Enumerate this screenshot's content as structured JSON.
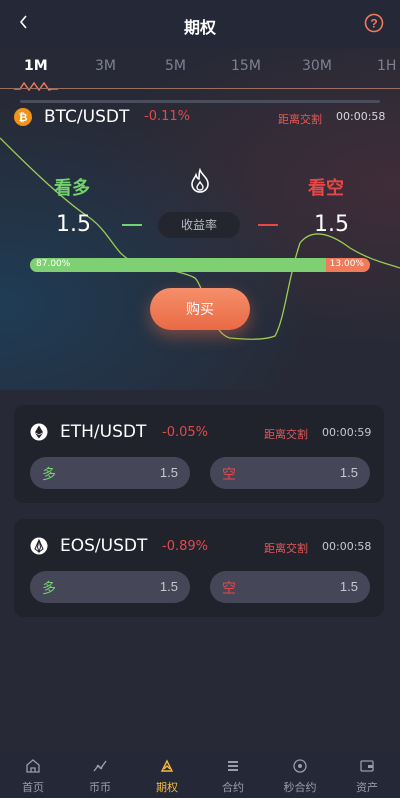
{
  "header": {
    "title": "期权"
  },
  "tabs": [
    "1M",
    "3M",
    "5M",
    "15M",
    "30M",
    "1H"
  ],
  "active_tab": "1M",
  "main_pair": {
    "name": "BTC/USDT",
    "change": "-0.11%",
    "countdown_label": "距离交割",
    "countdown": "00:00:58"
  },
  "trade": {
    "long_title": "看多",
    "short_title": "看空",
    "long_value": "1.5",
    "short_value": "1.5",
    "yield_label": "收益率",
    "long_ratio_label": "87.00%",
    "short_ratio_label": "13.00%",
    "long_ratio": 0.87,
    "buy_label": "购买"
  },
  "cards": [
    {
      "name": "ETH/USDT",
      "change": "-0.05%",
      "countdown_label": "距离交割",
      "countdown": "00:00:59",
      "long_label": "多",
      "long_value": "1.5",
      "short_label": "空",
      "short_value": "1.5"
    },
    {
      "name": "EOS/USDT",
      "change": "-0.89%",
      "countdown_label": "距离交割",
      "countdown": "00:00:58",
      "long_label": "多",
      "long_value": "1.5",
      "short_label": "空",
      "short_value": "1.5"
    }
  ],
  "nav": [
    {
      "label": "首页",
      "icon": "home-icon"
    },
    {
      "label": "币币",
      "icon": "trend-icon"
    },
    {
      "label": "期权",
      "icon": "options-icon"
    },
    {
      "label": "合约",
      "icon": "contract-icon"
    },
    {
      "label": "秒合约",
      "icon": "second-contract-icon"
    },
    {
      "label": "资产",
      "icon": "wallet-icon"
    }
  ],
  "colors": {
    "accent": "#f4b942",
    "long": "#74d26f",
    "short": "#e54848",
    "buy": "#ef7b5a"
  }
}
